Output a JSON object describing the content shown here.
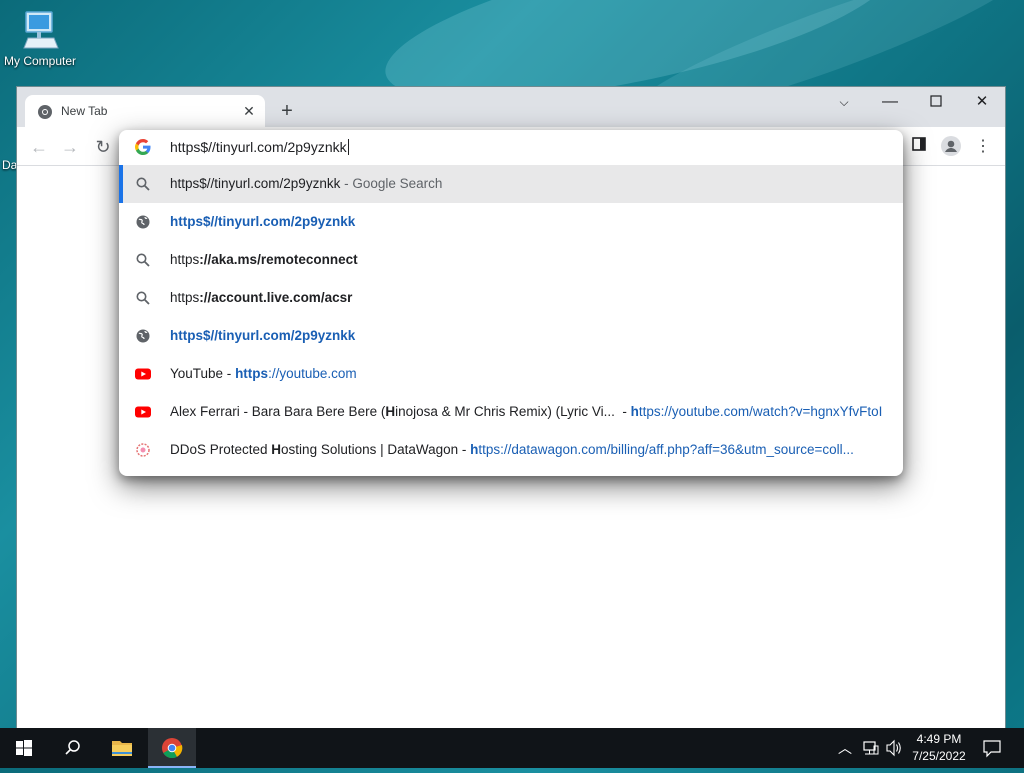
{
  "desktop": {
    "icon_label": "My Computer",
    "peek_label": "Da"
  },
  "browser": {
    "tab_title": "New Tab",
    "omnibox_value": "https$//tinyurl.com/2p9yznkk",
    "suggestions": [
      {
        "icon": "search-icon",
        "pre": "https$//tinyurl.com/2p9yznkk",
        "bold": "",
        "post": " - Google Search",
        "selected": true
      },
      {
        "icon": "globe-icon",
        "pre": "",
        "bold": "https$//tinyurl.com/2p9yznkk",
        "post": ""
      },
      {
        "icon": "search-icon",
        "pre": "https",
        "bold": "://aka.ms/remoteconnect",
        "post": ""
      },
      {
        "icon": "search-icon",
        "pre": "https",
        "bold": "://account.live.com/acsr",
        "post": ""
      },
      {
        "icon": "globe-icon",
        "pre": "",
        "bold": "https$//tinyurl.com/2p9yznkk",
        "post": ""
      },
      {
        "icon": "youtube-icon",
        "pre": "YouTube - ",
        "bold": "https",
        "post": "://youtube.com"
      },
      {
        "icon": "youtube-icon",
        "pre": "Alex Ferrari - Bara Bara Bere Bere (",
        "bold": "H",
        "post": "inojosa & Mr Chris Remix) (Lyric Vi...",
        "url_bold": "h",
        "url_rest": "ttps://youtube.com/watch?v=hgnxYfvFtoI"
      },
      {
        "icon": "datawagon-icon",
        "pre": "DDoS Protected ",
        "bold": "H",
        "post": "osting Solutions | DataWagon",
        "url_bold": "h",
        "url_rest": "ttps://datawagon.com/billing/aff.php?aff=36&utm_source=coll..."
      }
    ]
  },
  "taskbar": {
    "time": "4:49 PM",
    "date": "7/25/2022"
  }
}
